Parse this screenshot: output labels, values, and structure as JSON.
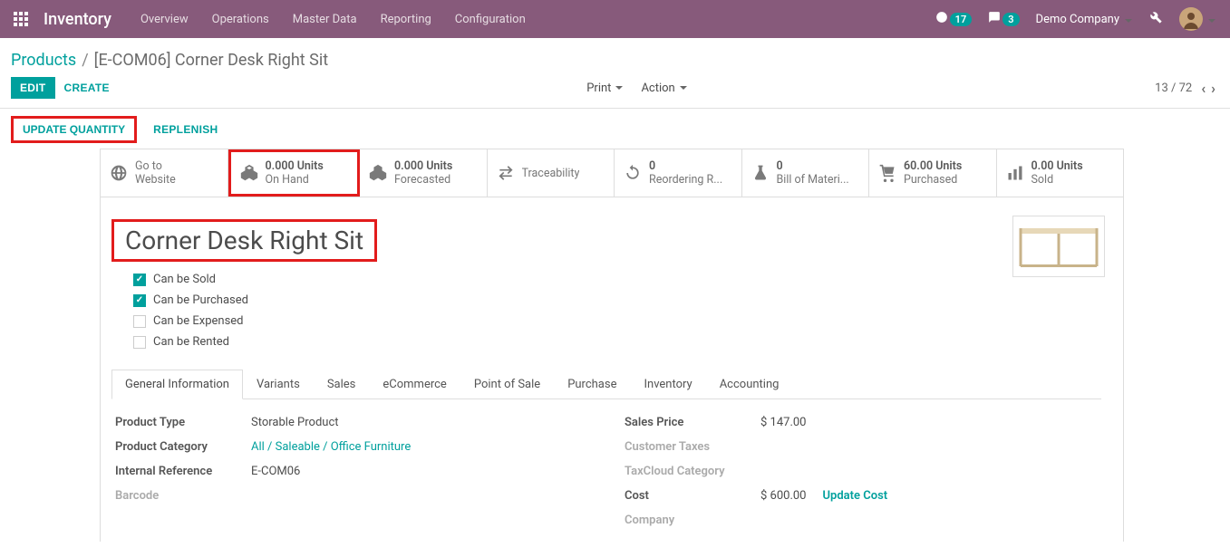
{
  "brand": "Inventory",
  "topnav": [
    "Overview",
    "Operations",
    "Master Data",
    "Reporting",
    "Configuration"
  ],
  "notif_clock": "17",
  "notif_chat": "3",
  "company": "Demo Company",
  "breadcrumb": {
    "root": "Products",
    "current": "[E-COM06] Corner Desk Right Sit"
  },
  "buttons": {
    "edit": "EDIT",
    "create": "CREATE",
    "print": "Print",
    "action": "Action",
    "update_qty": "UPDATE QUANTITY",
    "replenish": "REPLENISH",
    "update_cost": "Update Cost"
  },
  "pager": "13 / 72",
  "statcells": [
    {
      "val": "",
      "label1": "Go to",
      "label2": "Website"
    },
    {
      "val": "0.000 Units",
      "label": "On Hand"
    },
    {
      "val": "0.000 Units",
      "label": "Forecasted"
    },
    {
      "val": "",
      "label": "Traceability"
    },
    {
      "val": "0",
      "label": "Reordering R..."
    },
    {
      "val": "0",
      "label": "Bill of Materi..."
    },
    {
      "val": "60.00 Units",
      "label": "Purchased"
    },
    {
      "val": "0.00 Units",
      "label": "Sold"
    }
  ],
  "product_name": "Corner Desk Right Sit",
  "checks": [
    {
      "label": "Can be Sold",
      "checked": true
    },
    {
      "label": "Can be Purchased",
      "checked": true
    },
    {
      "label": "Can be Expensed",
      "checked": false
    },
    {
      "label": "Can be Rented",
      "checked": false
    }
  ],
  "tabs": [
    "General Information",
    "Variants",
    "Sales",
    "eCommerce",
    "Point of Sale",
    "Purchase",
    "Inventory",
    "Accounting"
  ],
  "fields_left": {
    "product_type": {
      "label": "Product Type",
      "value": "Storable Product"
    },
    "category": {
      "label": "Product Category",
      "value": "All / Saleable / Office Furniture"
    },
    "internal_ref": {
      "label": "Internal Reference",
      "value": "E-COM06"
    },
    "barcode": {
      "label": "Barcode",
      "value": ""
    }
  },
  "fields_right": {
    "sales_price": {
      "label": "Sales Price",
      "value": "$ 147.00"
    },
    "cust_taxes": {
      "label": "Customer Taxes",
      "value": ""
    },
    "taxcloud": {
      "label": "TaxCloud Category",
      "value": ""
    },
    "cost": {
      "label": "Cost",
      "value": "$ 600.00"
    },
    "company": {
      "label": "Company",
      "value": ""
    }
  }
}
